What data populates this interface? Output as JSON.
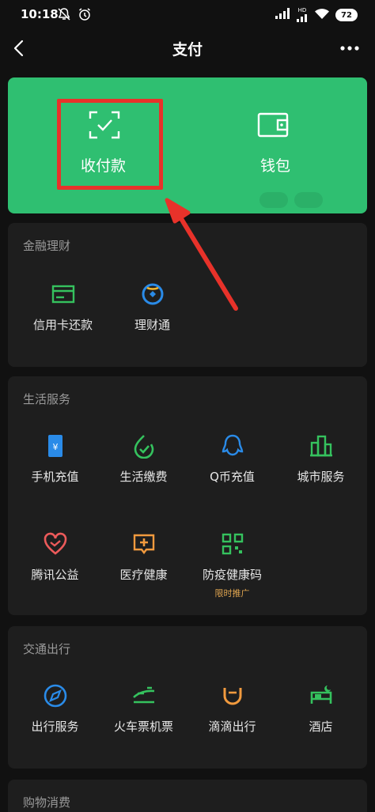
{
  "status_bar": {
    "time": "10:18",
    "battery": "72",
    "network": "HD"
  },
  "nav": {
    "title": "支付"
  },
  "hero": {
    "left_label": "收付款",
    "right_label": "钱包",
    "colors": {
      "background": "#2fbf71",
      "highlight": "#e8322a"
    }
  },
  "sections": [
    {
      "title": "金融理财",
      "items": [
        {
          "label": "信用卡还款",
          "icon": "credit-card-icon"
        },
        {
          "label": "理财通",
          "icon": "wealth-icon"
        }
      ]
    },
    {
      "title": "生活服务",
      "items": [
        {
          "label": "手机充值",
          "icon": "phone-topup-icon"
        },
        {
          "label": "生活缴费",
          "icon": "utility-bill-icon"
        },
        {
          "label": "Q币充值",
          "icon": "qq-coin-icon"
        },
        {
          "label": "城市服务",
          "icon": "city-service-icon"
        },
        {
          "label": "腾讯公益",
          "icon": "charity-icon"
        },
        {
          "label": "医疗健康",
          "icon": "medical-icon"
        },
        {
          "label": "防疫健康码",
          "icon": "qr-code-icon",
          "sublabel": "限时推广"
        }
      ]
    },
    {
      "title": "交通出行",
      "items": [
        {
          "label": "出行服务",
          "icon": "compass-icon"
        },
        {
          "label": "火车票机票",
          "icon": "train-icon"
        },
        {
          "label": "滴滴出行",
          "icon": "didi-icon"
        },
        {
          "label": "酒店",
          "icon": "hotel-bed-icon"
        }
      ]
    },
    {
      "title": "购物消费"
    }
  ]
}
